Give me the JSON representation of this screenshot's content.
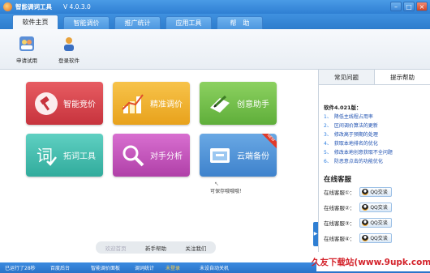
{
  "window": {
    "title": "智能调词工具",
    "version": "V 4.0.3.0"
  },
  "tabs": [
    {
      "label": "软件主页"
    },
    {
      "label": "智能调价"
    },
    {
      "label": "推广统计"
    },
    {
      "label": "应用工具"
    },
    {
      "label": "帮　助"
    }
  ],
  "toolbar": {
    "apply_trial": "申请试用",
    "login": "登录软件"
  },
  "tiles": [
    {
      "label": "智能竞价",
      "icon": "gavel-icon"
    },
    {
      "label": "精准调价",
      "icon": "bar-chart-icon"
    },
    {
      "label": "创意助手",
      "icon": "pen-paper-icon"
    },
    {
      "label": "拓词工具",
      "icon": "word-icon"
    },
    {
      "label": "对手分析",
      "icon": "magnifier-icon"
    },
    {
      "label": "云端备份",
      "icon": "cloud-folder-icon",
      "badge": "NEW"
    }
  ],
  "hint": "可保存哦哦哦！",
  "bottom_links": {
    "welcome": "欢迎首页",
    "newbie": "新手帮助",
    "about": "关注我们"
  },
  "right_panel": {
    "tabs": [
      {
        "label": "常见问题"
      },
      {
        "label": "提示帮助"
      }
    ],
    "version_title": "软件4.021版：",
    "news": [
      "降低主线程占用率",
      "区间调价算法的更新",
      "修改高于预期的处理",
      "获取本地排名的优化",
      "修改本地创意获取不全问题",
      "防恶意点击的功能优化"
    ],
    "cs_title": "在线客服",
    "cs": [
      {
        "label": "在线客服①：",
        "btn": "QQ交谈"
      },
      {
        "label": "在线客服②：",
        "btn": "QQ交谈"
      },
      {
        "label": "在线客服③：",
        "btn": "QQ交谈"
      },
      {
        "label": "在线客服④：",
        "btn": "QQ交谈"
      }
    ]
  },
  "status": {
    "s1": "已运行了28秒",
    "s2": "百度后台",
    "s3": "智能调价面板",
    "s4": "调词统计",
    "s5": "未登录",
    "s6": "未设自动关机"
  },
  "watermark": "久友下载站(www.9upk.com)"
}
